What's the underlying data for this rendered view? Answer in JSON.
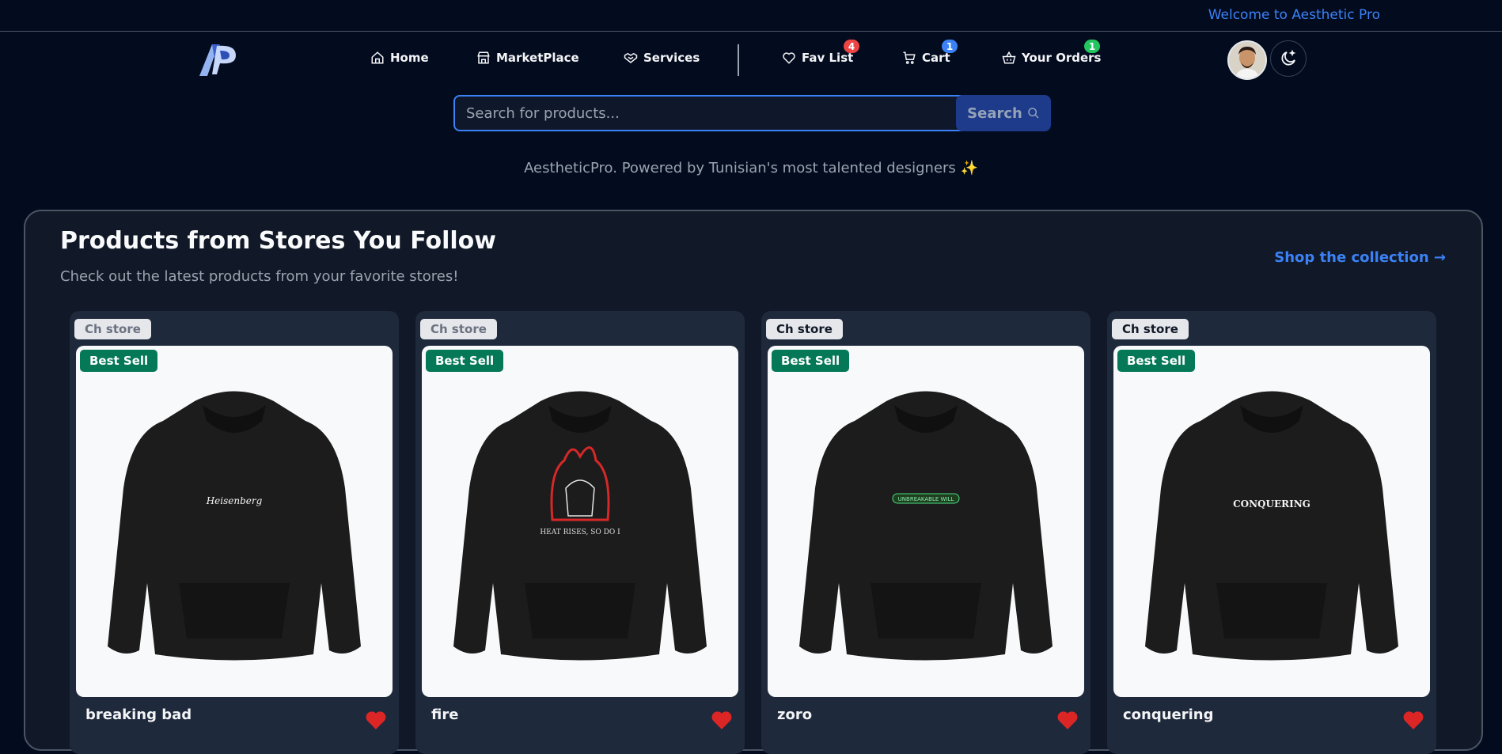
{
  "header": {
    "welcome": "Welcome to Aesthetic Pro"
  },
  "nav": {
    "home": "Home",
    "marketplace": "MarketPlace",
    "services": "Services",
    "fav_list": "Fav List",
    "fav_count": "4",
    "cart": "Cart",
    "cart_count": "1",
    "orders": "Your Orders",
    "orders_count": "1"
  },
  "search": {
    "placeholder": "Search for products...",
    "button": "Search"
  },
  "tagline": "AestheticPro. Powered by Tunisian's most talented designers ✨",
  "section": {
    "title": "Products from Stores You Follow",
    "subtitle": "Check out the latest products from your favorite stores!",
    "link": "Shop the collection →"
  },
  "products": [
    {
      "store": "Ch store",
      "badge": "Best Sell",
      "name": "breaking bad",
      "print": "Heisenberg"
    },
    {
      "store": "Ch store",
      "badge": "Best Sell",
      "name": "fire",
      "print": "HEAT RISES, SO DO I"
    },
    {
      "store": "Ch store",
      "badge": "Best Sell",
      "name": "zoro",
      "print": "UNBREAKABLE WILL"
    },
    {
      "store": "Ch store",
      "badge": "Best Sell",
      "name": "conquering",
      "print": "CONQUERING"
    }
  ],
  "colors": {
    "background": "#030b1f",
    "accent": "#3b82f6",
    "badge_red": "#ef4444",
    "badge_blue": "#3b82f6",
    "badge_green": "#22c55e",
    "best_sell": "#047857"
  }
}
